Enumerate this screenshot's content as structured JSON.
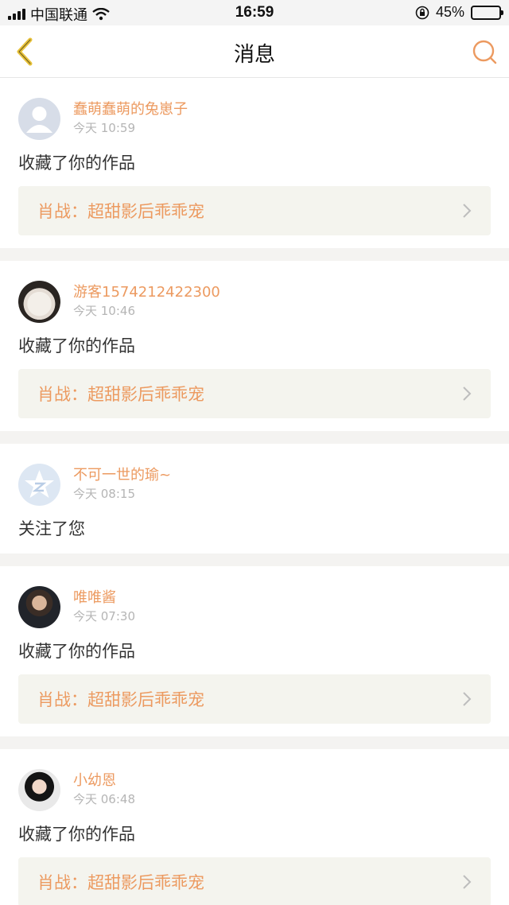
{
  "status_bar": {
    "carrier": "中国联通",
    "time": "16:59",
    "battery": "45%",
    "battery_level": 0.45
  },
  "nav": {
    "title": "消息",
    "back_icon": "chevron-left-icon",
    "search_icon": "search-icon"
  },
  "colors": {
    "accent": "#ec9a60",
    "back_arrow": "#e8c23a",
    "link_bg": "#f4f4ee"
  },
  "messages": [
    {
      "user": "蠢萌蠢萌的兔崽子",
      "time": "今天 10:59",
      "action": "收藏了你的作品",
      "work": "肖战：超甜影后乖乖宠"
    },
    {
      "user": "游客1574212422300",
      "time": "今天 10:46",
      "action": "收藏了你的作品",
      "work": "肖战：超甜影后乖乖宠"
    },
    {
      "user": "不可一世的瑜~",
      "time": "今天 08:15",
      "action": "关注了您"
    },
    {
      "user": "唯唯酱",
      "time": "今天 07:30",
      "action": "收藏了你的作品",
      "work": "肖战：超甜影后乖乖宠"
    },
    {
      "user": "小幼恩",
      "time": "今天 06:48",
      "action": "收藏了你的作品",
      "work": "肖战：超甜影后乖乖宠"
    }
  ]
}
